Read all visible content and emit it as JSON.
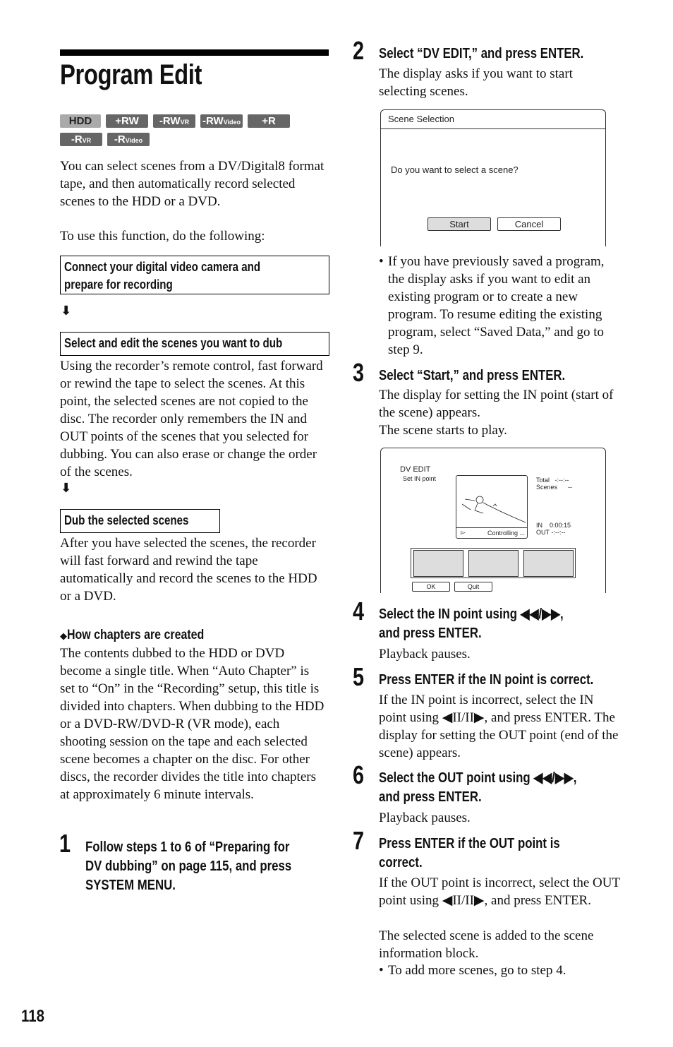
{
  "page": {
    "title": "Program Edit",
    "page_number": "118",
    "badges": [
      {
        "main": "HDD",
        "sub": ""
      },
      {
        "main": "+RW",
        "sub": ""
      },
      {
        "main": "-RW",
        "sub": "VR"
      },
      {
        "main": "-RW",
        "sub": "Video"
      },
      {
        "main": "+R",
        "sub": ""
      },
      {
        "main": "-R",
        "sub": "VR"
      },
      {
        "main": "-R",
        "sub": "Video"
      }
    ],
    "intro": "You can select scenes from a DV/Digital8 format tape, and then automatically record selected scenes to the HDD or a DVD.",
    "intro2": "To use this function, do the following:",
    "flow": [
      {
        "box": "Connect your digital video camera and prepare for recording",
        "line1": "Connect your digital video camera and",
        "line2": "prepare for recording",
        "body": ""
      },
      {
        "box": "Select and edit the scenes you want to dub",
        "body": "Using the recorder’s remote control, fast forward or rewind the tape to select the scenes. At this point, the selected scenes are not copied to the disc. The recorder only remembers the IN and OUT points of the scenes that you selected for dubbing. You can also erase or change the order of the scenes."
      },
      {
        "box": "Dub the selected scenes",
        "body": "After you have selected the scenes, the recorder will fast forward and rewind the tape automatically and record the scenes to the HDD or a DVD."
      }
    ],
    "arrow_glyph": "⬇",
    "chapters_heading": "How chapters are created",
    "chapters_body": "The contents dubbed to the HDD or DVD become a single title. When “Auto Chapter” is set to “On” in the “Recording” setup, this title is divided into chapters. When dubbing to the HDD or a DVD-RW/DVD-R (VR mode), each shooting session on the tape and each selected scene becomes a chapter on the disc. For other discs, the recorder divides the title into chapters at approximately 6 minute intervals.",
    "steps": [
      {
        "num": "1",
        "head_lines": [
          "Follow steps 1 to 6 of “Preparing for",
          "DV dubbing” on page 115, and press",
          "SYSTEM MENU."
        ],
        "body": ""
      },
      {
        "num": "2",
        "head_lines": [
          "Select “DV EDIT,” and press ENTER."
        ],
        "body": "The display asks if you want to start selecting scenes.",
        "note": "If you have previously saved a program, the display asks if you want to edit an existing program or to create a new program. To resume editing the existing program, select “Saved Data,” and go to step 9."
      },
      {
        "num": "3",
        "head_lines": [
          "Select “Start,” and press ENTER."
        ],
        "body": "The display for setting the IN point (start of the scene) appears.",
        "body2": "The scene starts to play."
      },
      {
        "num": "4",
        "head_lines": [
          "Select the IN point using ◀◀/▶▶,",
          "and press ENTER."
        ],
        "body": "Playback pauses."
      },
      {
        "num": "5",
        "head_lines": [
          "Press ENTER if the IN point is correct."
        ],
        "body": "If the IN point is incorrect, select the IN point using ◀II/II▶, and press ENTER. The display for setting the OUT point (end of the scene) appears."
      },
      {
        "num": "6",
        "head_lines": [
          "Select the OUT point using ◀◀/▶▶,",
          "and press ENTER."
        ],
        "body": "Playback pauses."
      },
      {
        "num": "7",
        "head_lines": [
          "Press ENTER if the OUT point is",
          "correct."
        ],
        "body": "If the OUT point is incorrect, select the OUT point using ◀II/II▶, and press ENTER.",
        "body2": "The selected scene is added to the scene information block.",
        "note": "To add more scenes, go to step 4."
      }
    ]
  },
  "scene_dialog": {
    "title": "Scene Selection",
    "question": "Do you want to select a scene?",
    "start_label": "Start",
    "cancel_label": "Cancel"
  },
  "dv_edit": {
    "title": "DV EDIT",
    "subtitle": "Set IN point",
    "total_label": "Total",
    "total_value": "-:--:--",
    "scenes_label": "Scenes",
    "scenes_value": "--",
    "in_label": "IN",
    "in_value": "0:00:15",
    "out_label": "OUT",
    "out_value": "-:--:--",
    "status": "Controlling ...",
    "ok_label": "OK",
    "quit_label": "Quit"
  }
}
